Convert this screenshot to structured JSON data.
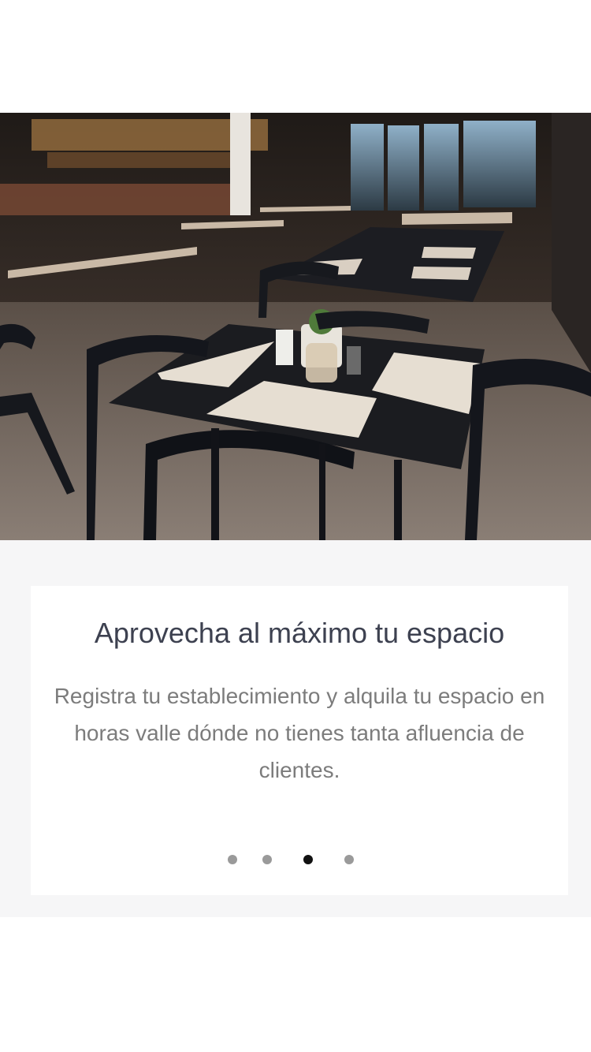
{
  "onboarding": {
    "hero_image": "restaurant-interior-photo",
    "title": "Aprovecha al máximo tu espacio",
    "description": "Registra tu establecimiento y alquila tu espacio en horas valle dónde no tienes tanta afluencia de clientes.",
    "pagination": {
      "total_pages": 4,
      "current_page": 3
    }
  },
  "colors": {
    "title": "#3d4150",
    "description": "#7c7c7c",
    "dot_inactive": "#9a9a9a",
    "dot_active": "#111111",
    "band_background": "#f6f6f7"
  }
}
